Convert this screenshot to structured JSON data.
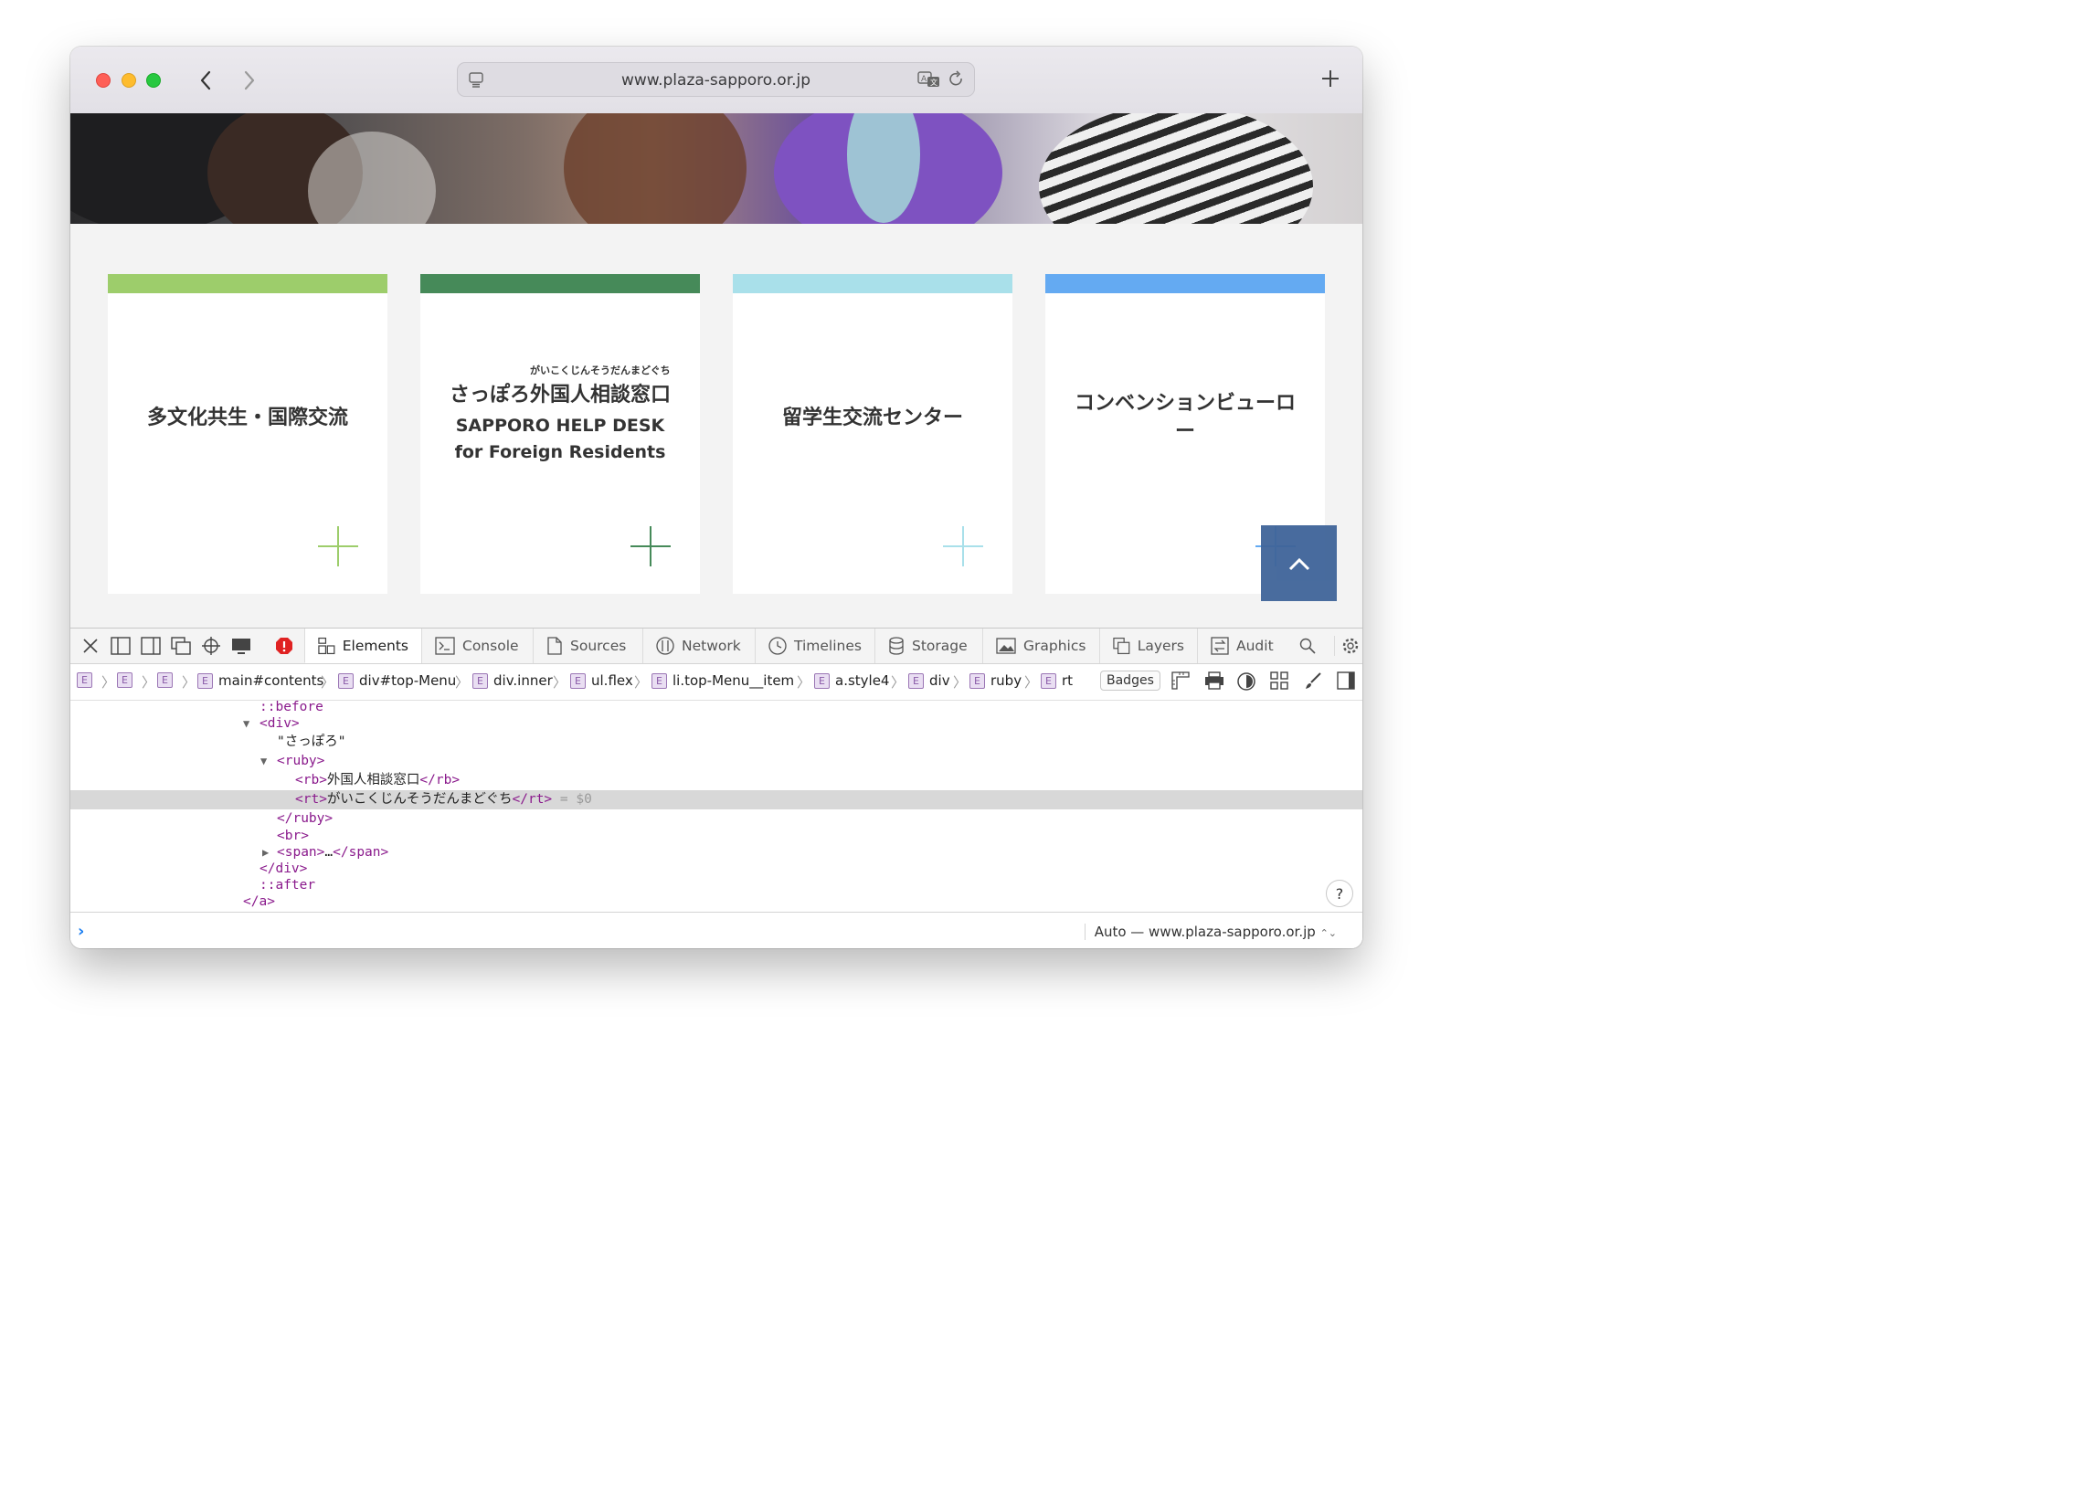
{
  "browser": {
    "url": "www.plaza-sapporo.or.jp"
  },
  "cards": [
    {
      "title": "多文化共生・国際交流",
      "color": "#9dcd6b"
    },
    {
      "ruby": "がいこくじんそうだんまどぐち",
      "title": "さっぽろ外国人相談窓口",
      "subtitle1": "SAPPORO HELP DESK",
      "subtitle2": "for Foreign Residents",
      "color": "#468a59"
    },
    {
      "title": "留学生交流センター",
      "color": "#a9e0ea"
    },
    {
      "title_line1": "コンベンションビューロ",
      "title_line2": "ー",
      "color": "#64aaf2"
    }
  ],
  "devtools": {
    "tabs": [
      "Elements",
      "Console",
      "Sources",
      "Network",
      "Timelines",
      "Storage",
      "Graphics",
      "Layers",
      "Audit"
    ],
    "breadcrumbs": [
      "",
      "",
      "",
      "main#contents",
      "div#top-Menu",
      "div.inner",
      "ul.flex",
      "li.top-Menu__item",
      "a.style4",
      "div",
      "ruby",
      "rt"
    ],
    "badge_letter": "E",
    "badges_label": "Badges",
    "code": {
      "before": "::before",
      "div_open": "<div>",
      "text_sapporo": "\"さっぽろ\"",
      "ruby_open": "<ruby>",
      "rb_open": "<rb>",
      "rb_text": "外国人相談窓口",
      "rb_close": "</rb>",
      "rt_open": "<rt>",
      "rt_text": "がいこくじんそうだんまどぐち",
      "rt_close": "</rt>",
      "dollar": "= $0",
      "ruby_close": "</ruby>",
      "br": "<br>",
      "span_open": "<span>",
      "ellipsis": "…",
      "span_close": "</span>",
      "div_close": "</div>",
      "after": "::after",
      "a_close": "</a>"
    },
    "console_context": "Auto — www.plaza-sapporo.or.jp",
    "help_label": "?"
  }
}
